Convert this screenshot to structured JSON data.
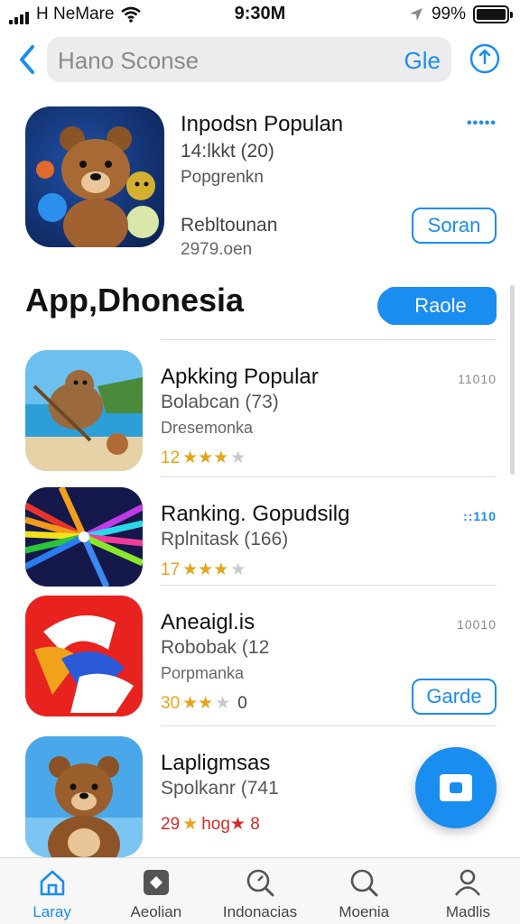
{
  "status": {
    "carrier": "H NeMare",
    "time": "9:30M",
    "battery": "99%"
  },
  "search": {
    "placeholder": "Hano Sconse",
    "go_label": "Gle"
  },
  "featured": {
    "title": "Inpodsn Populan",
    "sub1": "14:lkkt (20)",
    "sub2": "Popgrenkn",
    "sub3": "Rebltounan",
    "sub4": "2979.oen",
    "dots": "•••••",
    "button": "Soran"
  },
  "section": {
    "title": "App,Dhonesia",
    "button": "Raole"
  },
  "apps": [
    {
      "name": "Apkking Popular",
      "meta1": "Bolabcan (73)",
      "meta2": "Dresemonka",
      "rating_num": "12",
      "stars": 3.5,
      "rating_after": "",
      "dots": "11010",
      "dots_blue": false,
      "button": ""
    },
    {
      "name": "Ranking. Gopudsilg",
      "meta1": "Rplnitask (166)",
      "meta2": "",
      "rating_num": "17",
      "stars": 3.5,
      "rating_after": "",
      "dots": "::110",
      "dots_blue": true,
      "button": ""
    },
    {
      "name": "Aneaigl.is",
      "meta1": "Robobak (12",
      "meta2": "Porpmanka",
      "rating_num": "30",
      "stars": 2,
      "rating_after": "0",
      "dots": "10010",
      "dots_blue": false,
      "button": "Garde"
    },
    {
      "name": "Lapligmsas",
      "meta1": "Spolkanr (741",
      "meta2": "",
      "rating_num": "29",
      "stars": 1,
      "rating_after": "hog★ 8",
      "dots": "",
      "dots_blue": false,
      "button": ""
    }
  ],
  "tabs": [
    {
      "label": "Laray",
      "icon": "home-icon",
      "active": true
    },
    {
      "label": "Aeolian",
      "icon": "apps-icon",
      "active": false
    },
    {
      "label": "Indonacias",
      "icon": "search-icon",
      "active": false
    },
    {
      "label": "Moenia",
      "icon": "search-icon",
      "active": false
    },
    {
      "label": "Madlis",
      "icon": "person-icon",
      "active": false
    }
  ],
  "colors": {
    "accent": "#1a8df0",
    "star": "#e8a31a"
  }
}
